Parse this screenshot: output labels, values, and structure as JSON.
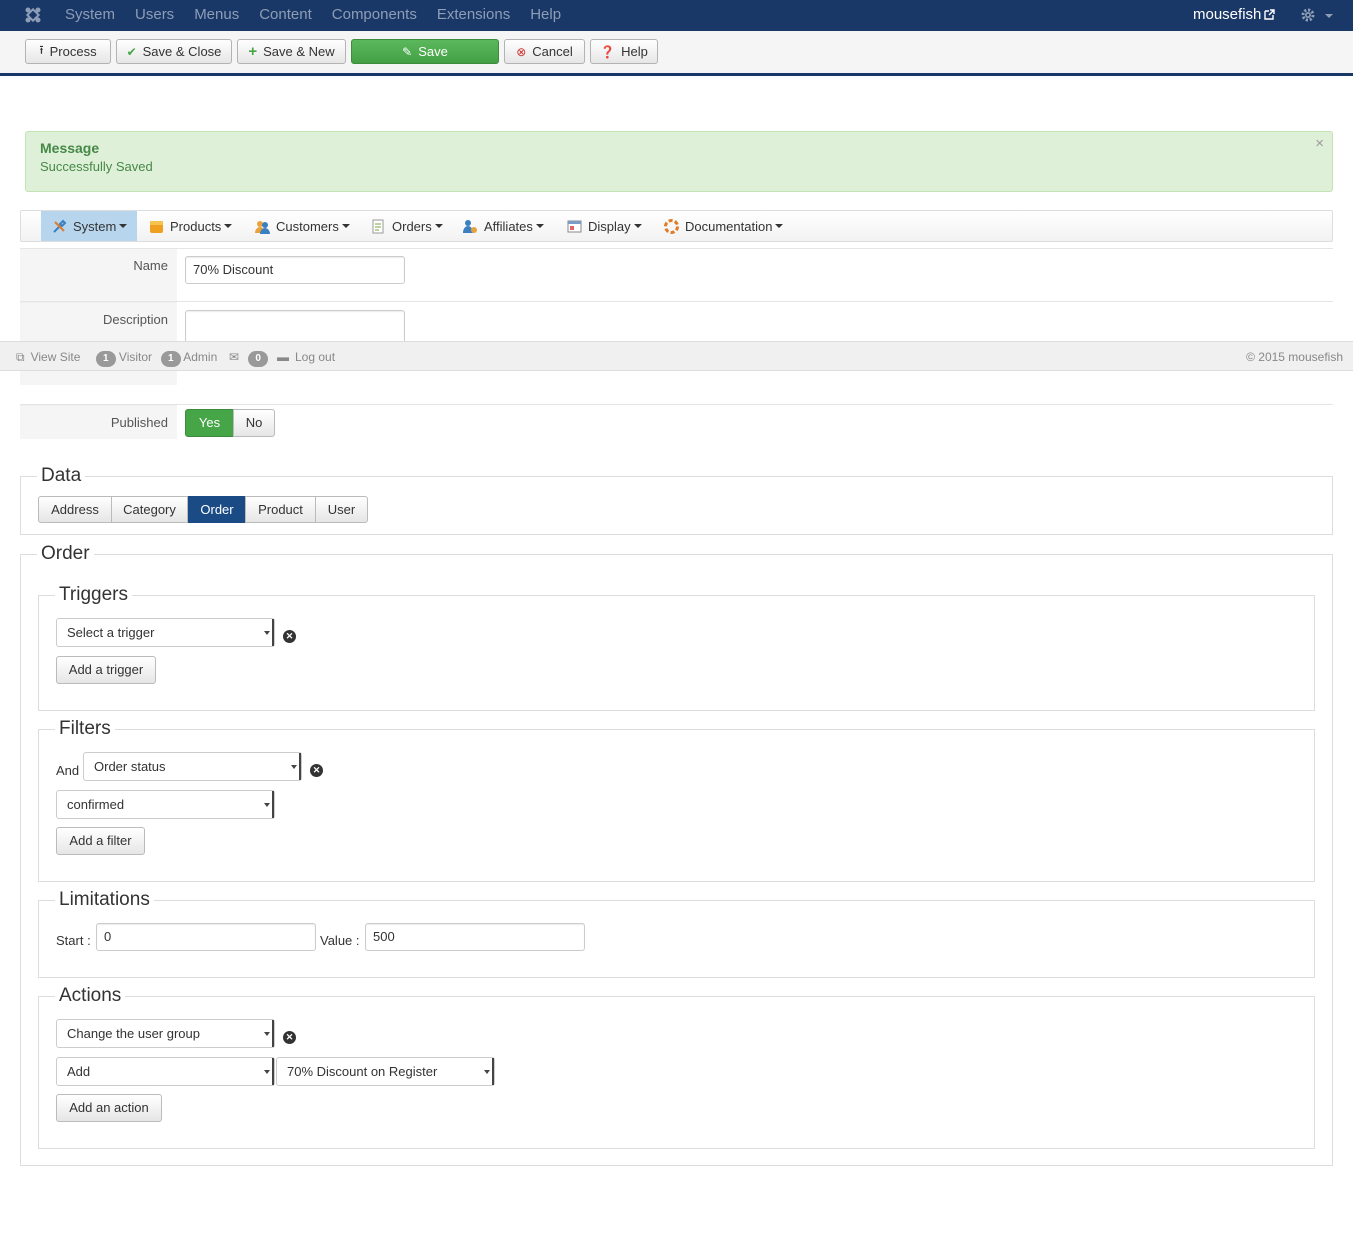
{
  "topnav": {
    "menu": [
      "System",
      "Users",
      "Menus",
      "Content",
      "Components",
      "Extensions",
      "Help"
    ],
    "user": "mousefish"
  },
  "toolbar": {
    "process": "Process",
    "save_close": "Save & Close",
    "save_new": "Save & New",
    "save": "Save",
    "cancel": "Cancel",
    "help": "Help"
  },
  "message": {
    "heading": "Message",
    "text": "Successfully Saved",
    "close": "×"
  },
  "component_menu": [
    "System",
    "Products",
    "Customers",
    "Orders",
    "Affiliates",
    "Display",
    "Documentation"
  ],
  "form": {
    "name_label": "Name",
    "name_value": "70% Discount",
    "description_label": "Description",
    "published_label": "Published",
    "published_yes": "Yes",
    "published_no": "No"
  },
  "statusbar": {
    "view_site": "View Site",
    "visitor_count": "1",
    "visitor_label": "Visitor",
    "admin_count": "1",
    "admin_label": "Admin",
    "messages_count": "0",
    "logout": "Log out",
    "copyright": "© 2015 mousefish"
  },
  "data_section": {
    "legend": "Data",
    "tabs": [
      "Address",
      "Category",
      "Order",
      "Product",
      "User"
    ],
    "active_tab": "Order"
  },
  "order_section": {
    "legend": "Order",
    "triggers": {
      "legend": "Triggers",
      "select_value": "Select a trigger",
      "add_button": "Add a trigger"
    },
    "filters": {
      "legend": "Filters",
      "and_label": "And",
      "filter_value": "Order status",
      "status_value": "confirmed",
      "add_button": "Add a filter"
    },
    "limitations": {
      "legend": "Limitations",
      "start_label": "Start :",
      "start_value": "0",
      "value_label": "Value :",
      "value_value": "500"
    },
    "actions": {
      "legend": "Actions",
      "action_value": "Change the user group",
      "mode_value": "Add",
      "group_value": "70% Discount on Register",
      "add_button": "Add an action"
    }
  },
  "colors": {
    "navbar": "#1a3867",
    "save_green": "#46a546",
    "message_bg": "#dff0d8",
    "message_text": "#468847",
    "active_tab": "#1a4b85"
  }
}
